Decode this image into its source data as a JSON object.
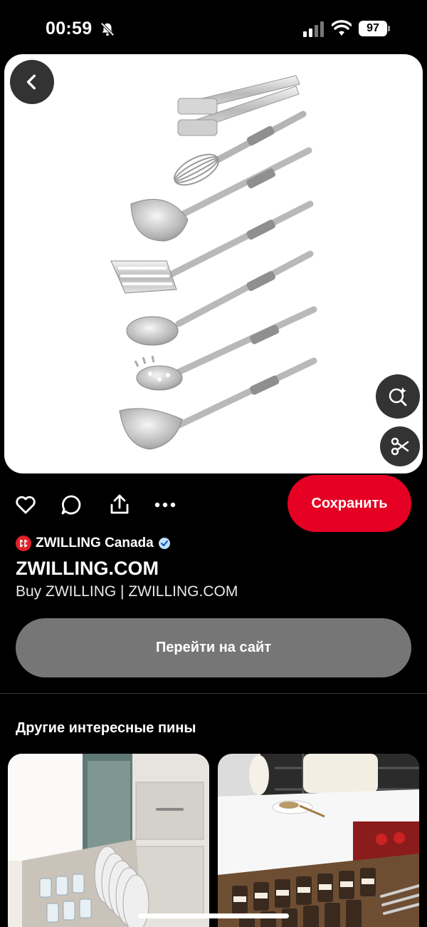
{
  "status_bar": {
    "time": "00:59",
    "battery": "97"
  },
  "pin": {
    "icons": [
      "back-icon",
      "visual-search-icon",
      "scissors-icon"
    ]
  },
  "actions": {
    "icons": [
      "heart-icon",
      "comment-icon",
      "share-icon",
      "more-icon"
    ],
    "save_label": "Сохранить"
  },
  "source": {
    "name": "ZWILLING Canada",
    "title": "ZWILLING.COM",
    "description": "Buy ZWILLING | ZWILLING.COM"
  },
  "visit_label": "Перейти на сайт",
  "more_pins": {
    "title": "Другие интересные пины"
  },
  "colors": {
    "save_red": "#e60023",
    "background": "#000000",
    "visit_gray": "#767676"
  }
}
